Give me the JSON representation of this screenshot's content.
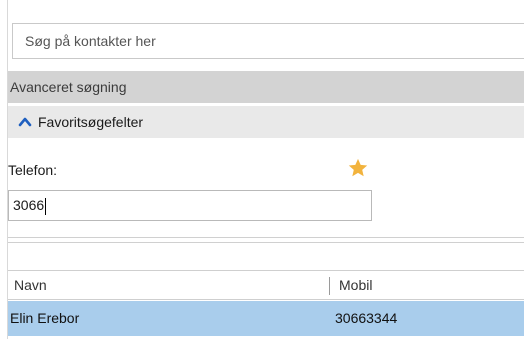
{
  "search": {
    "placeholder": "Søg på kontakter her"
  },
  "advanced": {
    "label": "Avanceret søgning"
  },
  "favorites": {
    "label": "Favoritsøgefelter"
  },
  "phone": {
    "label": "Telefon:",
    "value": "3066"
  },
  "icons": {
    "expand": "chevron-up-icon",
    "favorite": "star-icon"
  },
  "colors": {
    "accent": "#1f5fbf",
    "star": "#f2b33d",
    "selected_row": "#a9cdec",
    "header_bar": "#d3d3d3"
  },
  "results": {
    "columns": [
      "Navn",
      "Mobil"
    ],
    "rows": [
      {
        "name": "Elin Erebor",
        "mobile": "30663344"
      }
    ]
  }
}
